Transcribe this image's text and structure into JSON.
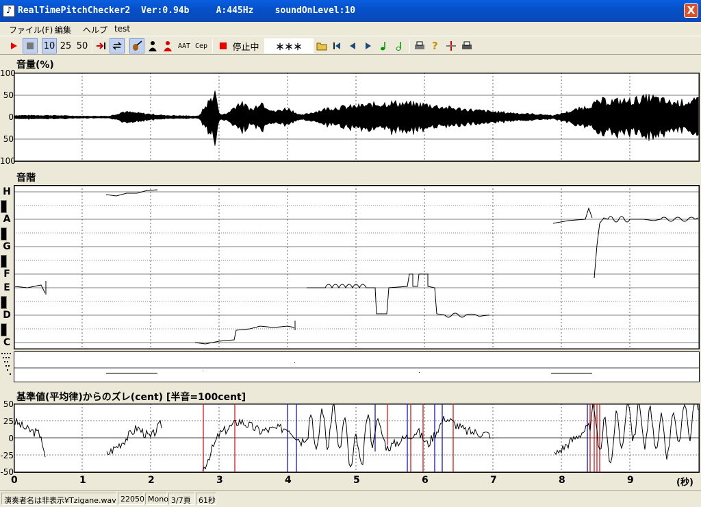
{
  "window": {
    "title": "RealTimePitchChecker2  Ver:0.94b     A:445Hz    soundOnLevel:10",
    "close_glyph": "X"
  },
  "menu": [
    "ファイル(F)",
    "編集",
    "ヘルプ",
    "test"
  ],
  "toolbar": {
    "speed_10": "10",
    "speed_25": "25",
    "speed_50": "50",
    "aat": "AAT",
    "cep": "Cep",
    "status": "停止中",
    "readout": "＊＊＊"
  },
  "volume": {
    "title": "音量(%)",
    "ticks": [
      "100",
      "50",
      "0",
      "50",
      "100"
    ]
  },
  "scale": {
    "title": "音階",
    "notes": [
      "H",
      "A",
      "G",
      "F",
      "E",
      "D",
      "C"
    ]
  },
  "deviation": {
    "title": "基準値(平均律)からのズレ(cent) [半音=100cent]",
    "ticks": [
      "50",
      "25",
      "0",
      "-25",
      "-50"
    ]
  },
  "time_axis": {
    "ticks": [
      "0",
      "1",
      "2",
      "3",
      "4",
      "5",
      "6",
      "7",
      "8",
      "9"
    ],
    "unit": "(秒)"
  },
  "statusbar": {
    "file": "演奏者名は非表示¥Tzigane.wav",
    "rate": "22050",
    "channels": "Mono",
    "page": "3/7頁",
    "length": "61秒"
  },
  "chart_data": [
    {
      "type": "area",
      "ylabel": "音量(%)",
      "x": [
        0,
        0.5,
        1,
        1.4,
        1.6,
        2.2,
        2.7,
        2.95,
        3.0,
        3.1,
        3.3,
        3.5,
        3.6,
        3.8,
        4.0,
        4.2,
        4.6,
        5.0,
        5.5,
        6.0,
        6.4,
        7.0,
        7.9,
        8.3,
        8.6,
        9.0,
        9.3,
        9.6,
        10.0
      ],
      "values": [
        5,
        5,
        3,
        3,
        15,
        5,
        3,
        70,
        10,
        8,
        40,
        20,
        45,
        15,
        25,
        5,
        25,
        30,
        40,
        35,
        25,
        15,
        5,
        25,
        45,
        45,
        55,
        40,
        45
      ],
      "ylim": [
        -100,
        100
      ]
    },
    {
      "type": "line",
      "ylabel": "基準値(平均律)からのズレ(cent) [半音=100cent]",
      "x": [
        0,
        0.2,
        0.4,
        0.45,
        1.35,
        1.6,
        1.8,
        2.0,
        2.15,
        2.75,
        3.0,
        3.3,
        3.6,
        4.0,
        4.2,
        4.3,
        4.7,
        5.0,
        5.3,
        5.45,
        5.9,
        6.05,
        6.3,
        6.6,
        6.95,
        7.9,
        8.2,
        8.45,
        8.7,
        9.0,
        9.5,
        10.0
      ],
      "values": [
        25,
        12,
        5,
        -30,
        -25,
        -5,
        15,
        0,
        20,
        -50,
        5,
        25,
        10,
        15,
        -5,
        5,
        20,
        -30,
        30,
        -15,
        10,
        -10,
        30,
        10,
        5,
        -25,
        0,
        20,
        -10,
        30,
        0,
        40
      ],
      "ylim": [
        -50,
        50
      ]
    }
  ]
}
